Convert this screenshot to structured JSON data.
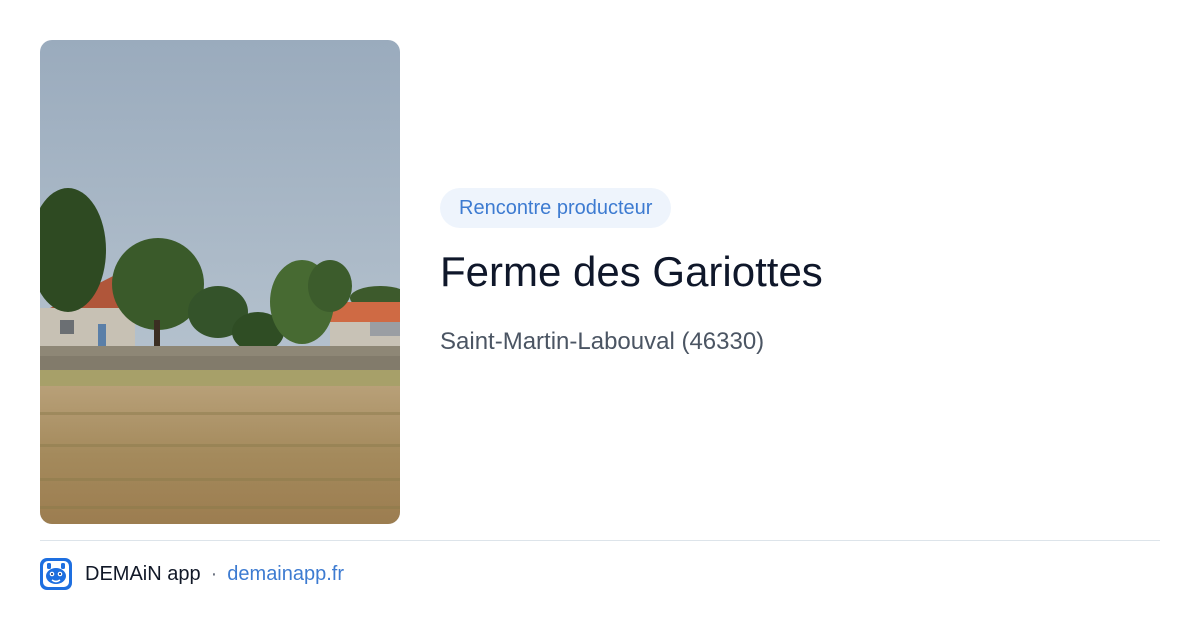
{
  "badge": {
    "label": "Rencontre producteur"
  },
  "title": "Ferme des Gariottes",
  "location": "Saint-Martin-Labouval (46330)",
  "photo": {
    "icon": "farm-landscape-photo"
  },
  "footer": {
    "app_name": "DEMAiN app",
    "separator": "·",
    "site": "demainapp.fr",
    "icon": "demain-logo-icon"
  },
  "colors": {
    "accent": "#3d7bd1",
    "badge_bg": "#eef4fc",
    "title": "#0f172a",
    "subtitle": "#4b5563"
  }
}
